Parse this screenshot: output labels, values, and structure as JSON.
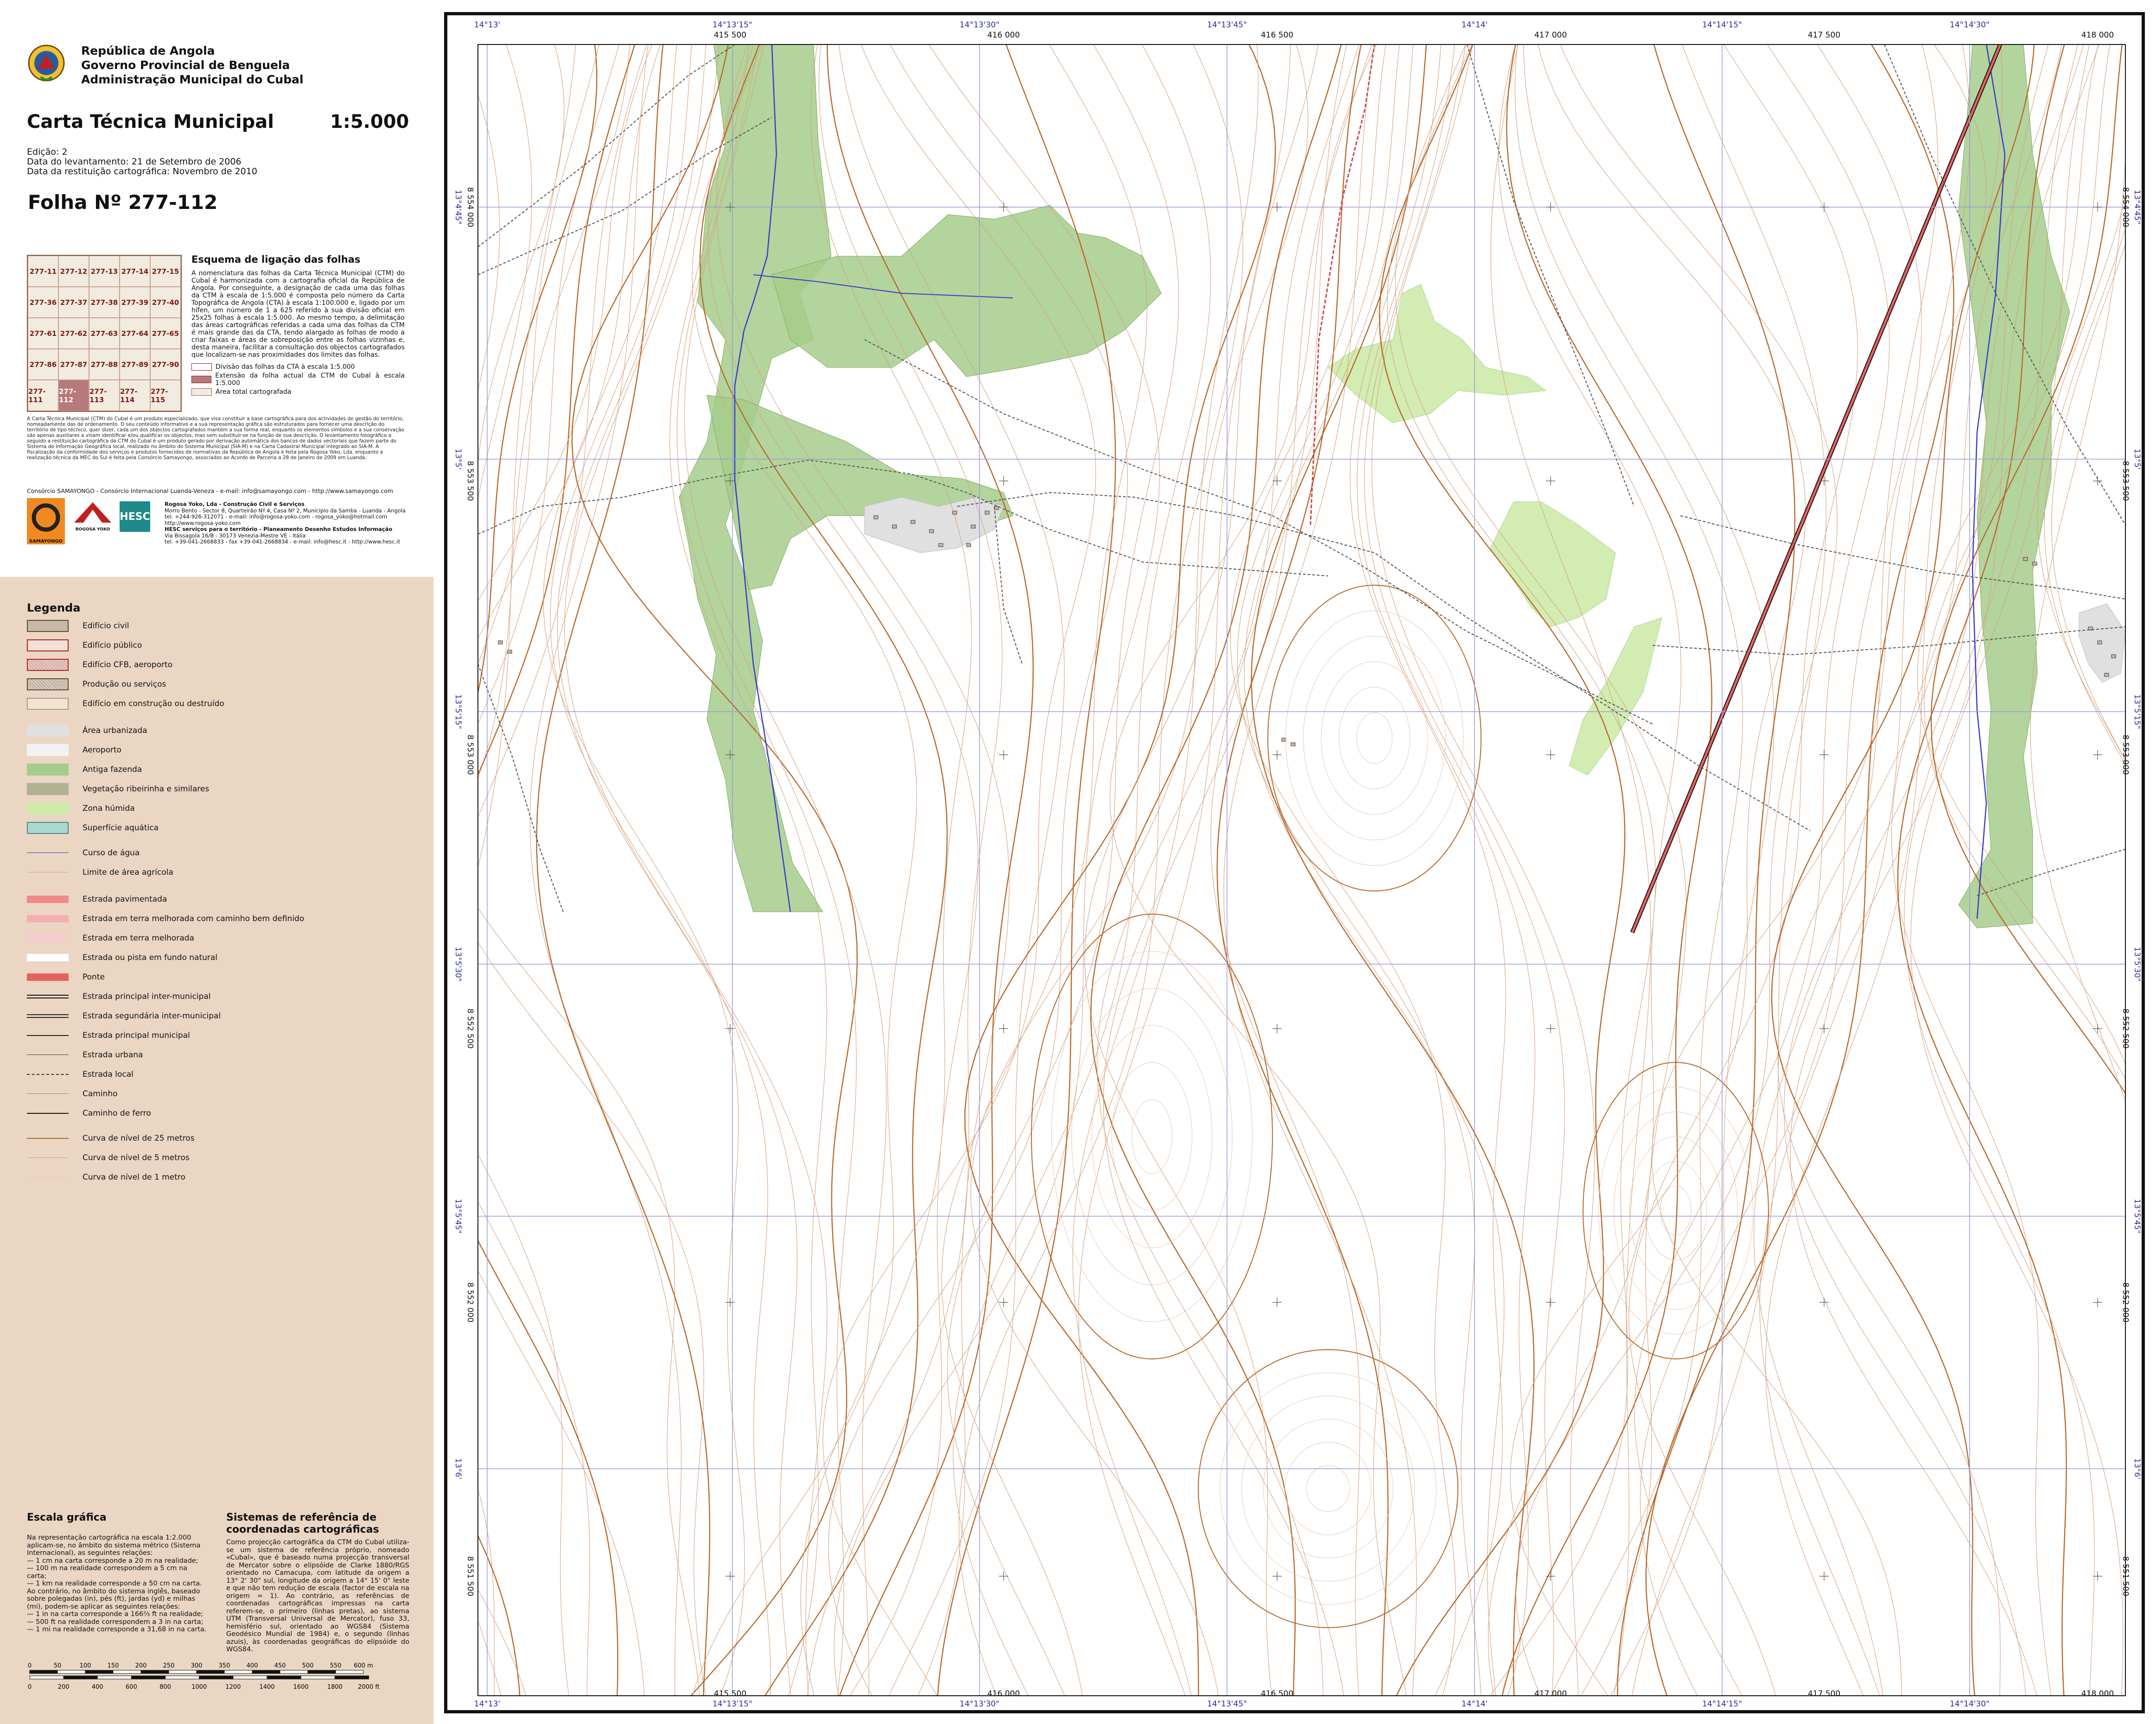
{
  "header": {
    "org_lines": [
      "República de Angola",
      "Governo Provincial de Benguela",
      "Administração Municipal do Cubal"
    ],
    "title": "Carta Técnica Municipal",
    "scale": "1:5.000",
    "edition": "Edição: 2",
    "survey_date": "Data do levantamento: 21 de Setembro de 2006",
    "restitution_date": "Data da restituição cartográfica: Novembro de 2010",
    "sheet_label": "Folha Nº  277-112"
  },
  "sheet_index": {
    "cells": [
      "277-11",
      "277-12",
      "277-13",
      "277-14",
      "277-15",
      "277-36",
      "277-37",
      "277-38",
      "277-39",
      "277-40",
      "277-61",
      "277-62",
      "277-63",
      "277-64",
      "277-65",
      "277-86",
      "277-87",
      "277-88",
      "277-89",
      "277-90",
      "277-111",
      "277-112",
      "277-113",
      "277-114",
      "277-115"
    ],
    "current": "277-112"
  },
  "linking_scheme": {
    "title": "Esquema de ligação das folhas",
    "text": "A nomenclatura das folhas da Carta Técnica Municipal (CTM) do Cubal é harmonizada com a cartografia oficial da República de Angola. Por conseguinte, a designação de cada uma das folhas da CTM à escala de 1:5.000 é composta pelo número da Carta Topográfica de Angola (CTA) à escala 1:100.000 e, ligado por um hífen, um número de 1 a 625 referido à sua divisão oficial em 25x25 folhas à escala 1:5.000. Ao mesmo tempo, a delimitação das áreas cartográficas referidas a cada uma das folhas da CTM é mais grande das da CTA, tendo alargado as folhas de modo a criar faixas e áreas de sobreposição entre as folhas vizinhas e, desta maneira, facilitar a consultação dos objectos cartografados que localizam-se nas proximidades dos limites das folhas.",
    "keys": [
      "Divisão das folhas da CTA à escala 1:5.000",
      "Extensão da folha actual da CTM do Cubal à escala 1:5.000",
      "Área total cartografada"
    ]
  },
  "disclaimer": "A Carta Técnica Municipal (CTM) do Cubal é um produto especializado, que visa constituir a base cartográfica para dos actividades de gestão do território, nomeadamente das de ordenamento. O seu conteúdo informativo e a sua representação gráfica são estruturados para fornecer uma descrição do território de tipo técnico, quer dizer, cada um dos objectos cartografados mantém a sua forma real, enquanto os elementos símbolos e a sua conservação são apenas auxiliares a visam identificar e/ou qualificar os objectos, mas sem substituir-se na função de sua descrição. O levantamento fotográfico a seguido a restituição cartográfica da CTM do Cubal é um produto gerado por derivação automática dos bancos de dados vectoriais que fazem parte do Sistema de Informação Geográfica local, realizado no âmbito do Sistema Municipal (SIA-M) e na Carta Cadastral Municipal integrado ao SIA-M. A fiscalização da conformidade dos serviços e produtos fornecidos de normativas da República de Angola é feita pela Rogosa Yoko, Lda. enquanto a realização técnica da MEC do Sul é feita pela Consórcio Samayongo, associados ao Acordo de Parceria a 28 de Janeiro de 2009 em Luanda.",
  "consortium": {
    "line": "Consórcio SAMAYONGO - Consórcio Internacional Luanda-Veneza - e-mail: info@samayongo.com - http://www.samayongo.com",
    "logos": [
      "SAMAYONGO",
      "ROGOSA YOKO",
      "HESC"
    ],
    "contacts": [
      {
        "name": "Rogosa Yoko, Lda - Construção Civil e Serviços",
        "lines": [
          "Morro Bento - Sector 8, Quarteirão Nº 4, Casa Nº 2, Município da Samba - Luanda - Angola",
          "tel. +244-926-312071 - e-mail: info@rogosa-yoko.com - rogosa_yoko@hotmail.com",
          "http://www.rogosa-yoko.com"
        ]
      },
      {
        "name": "HESC serviços para o território - Planeamento Desenho Estudos Informação",
        "lines": [
          "Via Bissagola 16/B - 30173 Venezia-Mestre VE - Itália",
          "tel. +39-041-2668833 - fax +39-041-2668834 - e-mail: info@hesc.it - http://www.hesc.it"
        ]
      }
    ]
  },
  "legend": {
    "title": "Legenda",
    "items": [
      {
        "label": "Edifício civil",
        "kind": "fill",
        "fill": "#c8b8a8",
        "border": "#5a4a40"
      },
      {
        "label": "Edifício público",
        "kind": "fill",
        "fill": "#f2e0d8",
        "border": "#b81c1c"
      },
      {
        "label": "Edifício CFB, aeroporto",
        "kind": "hatch",
        "fill": "#e8c8c0",
        "border": "#b81c1c"
      },
      {
        "label": "Produção ou serviços",
        "kind": "hatch",
        "fill": "#d8c8b8",
        "border": "#5a4a40"
      },
      {
        "label": "Edifício em construção ou destruído",
        "kind": "fill",
        "fill": "#f3e3d3",
        "border": "#a89888"
      },
      {
        "label": "Área urbanizada",
        "kind": "fill",
        "fill": "#e0e0e0",
        "border": "none"
      },
      {
        "label": "Aeroporto",
        "kind": "fill",
        "fill": "#f2f2f2",
        "border": "none"
      },
      {
        "label": "Antiga fazenda",
        "kind": "fill",
        "fill": "#a6cc8c",
        "border": "none"
      },
      {
        "label": "Vegetação ribeirinha e similares",
        "kind": "fill",
        "fill": "#b0b290",
        "border": "none"
      },
      {
        "label": "Zona húmida",
        "kind": "fill",
        "fill": "#cdeaa8",
        "border": "none"
      },
      {
        "label": "Superfície aquática",
        "kind": "fill",
        "fill": "#a8d8d0",
        "border": "#4a8a8a"
      },
      {
        "label": "Curso de água",
        "kind": "line",
        "color": "#3a3ac8",
        "width": 1.5
      },
      {
        "label": "Limite de área agrícola",
        "kind": "line",
        "color": "#c8a898",
        "width": 1
      },
      {
        "label": "Estrada pavimentada",
        "kind": "band",
        "color": "#f08a8a"
      },
      {
        "label": "Estrada em terra melhorada com caminho bem definido",
        "kind": "band",
        "color": "#f3b0b0"
      },
      {
        "label": "Estrada em terra melhorada",
        "kind": "band",
        "color": "#f6cccc"
      },
      {
        "label": "Estrada ou pista em fundo natural",
        "kind": "band",
        "color": "#ffffff"
      },
      {
        "label": "Ponte",
        "kind": "band",
        "color": "#e86060"
      },
      {
        "label": "Estrada principal inter-municipal",
        "kind": "double",
        "color": "#111111"
      },
      {
        "label": "Estrada segundária inter-municipal",
        "kind": "double",
        "color": "#222222"
      },
      {
        "label": "Estrada principal municipal",
        "kind": "line",
        "color": "#222222",
        "width": 2
      },
      {
        "label": "Estrada urbana",
        "kind": "line",
        "color": "#444444",
        "width": 1.5
      },
      {
        "label": "Estrada local",
        "kind": "dashed",
        "color": "#333333"
      },
      {
        "label": "Caminho",
        "kind": "line",
        "color": "#888888",
        "width": 1
      },
      {
        "label": "Caminho de ferro",
        "kind": "line",
        "color": "#111111",
        "width": 2.5
      },
      {
        "label": "Curva de nível de 25 metros",
        "kind": "line",
        "color": "#b8682a",
        "width": 2
      },
      {
        "label": "Curva de nível de 5 metros",
        "kind": "line",
        "color": "#d4a07c",
        "width": 1.2
      },
      {
        "label": "Curva de nível de 1 metro",
        "kind": "line",
        "color": "#e6c8b0",
        "width": 0.8
      }
    ]
  },
  "scale_bar": {
    "title": "Escala gráfica",
    "text": [
      "Na representação cartográfica na escala 1:2.000 aplicam-se, no âmbito do sistema métrico (Sistema Internacional), as seguintes relações:",
      "— 1 cm na carta corresponde a 20 m na realidade;",
      "— 100 m na realidade correspondem a 5 cm na carta;",
      "— 1 km na realidade corresponde a 50 cm na carta.",
      "Ao contrário, no âmbito do sistema inglês, baseado sobre polegadas (in), pés (ft), jardas (yd) e milhas (mi), podem-se aplicar as seguintes relações:",
      "— 1 in na carta corresponde a 166⅔ ft na realidade;",
      "— 500 ft na realidade correspondem a 3 in na carta;",
      "— 1 mi na realidade corresponde a 31,68 in na carta."
    ],
    "meter_ticks": [
      "0",
      "50",
      "100",
      "150",
      "200",
      "250",
      "300",
      "350",
      "400",
      "450",
      "500",
      "550",
      "600 m"
    ],
    "foot_ticks": [
      "0",
      "200",
      "400",
      "600",
      "800",
      "1000",
      "1200",
      "1400",
      "1600",
      "1800",
      "2000 ft"
    ]
  },
  "reference_systems": {
    "title": "Sistemas de referência de coordenadas cartográficas",
    "text": "Como projecção cartográfica da CTM do Cubal utiliza-se um sistema de referência próprio, nomeado «Cubal», que é baseado numa projecção transversal de Mercator sobre o elipsóide de Clarke 1880/RGS orientado no Camacupa, com latitude da origem a 13° 2' 30\" sul, longitude da origem a 14° 15' 0\" leste e que não tem redução de escala (factor de escala na origem = 1). Ao contrário, as referências de coordenadas cartográficas impressas na carta referem-se, o primeiro (linhas pretas), ao sistema UTM (Transversal Universal de Mercator), fuso 33, hemisfério sul, orientado ao WGS84 (Sistema Geodésico Mundial de 1984) e, o segundo (linhas azuis), às coordenadas geográficas do elipsóide do WGS84."
  },
  "map_frame": {
    "geo_lon_labels": [
      "14°13'",
      "14°13'15\"",
      "14°13'30\"",
      "14°13'45\"",
      "14°14'",
      "14°14'15\"",
      "14°14'30\""
    ],
    "utm_e_labels": [
      "415 500",
      "416 000",
      "416 500",
      "417 000",
      "417 500",
      "418 000"
    ],
    "geo_lat_labels": [
      "13°4'45\"",
      "13°5'",
      "13°5'15\"",
      "13°5'30\"",
      "13°5'45\"",
      "13°6'"
    ],
    "utm_n_labels": [
      "8 554 000",
      "8 553 500",
      "8 553 000",
      "8 552 500",
      "8 552 000",
      "8 551 500"
    ],
    "colors": {
      "contour_major": "#b8682a",
      "contour_minor": "#d4a07c",
      "contour_fine": "#e6c8b0",
      "farm": "#a6cc8c",
      "wetland": "#cdeaa8",
      "river": "#3a3ac8",
      "geo_grid": "#9a9ad8",
      "utm_grid": "#555555"
    }
  }
}
